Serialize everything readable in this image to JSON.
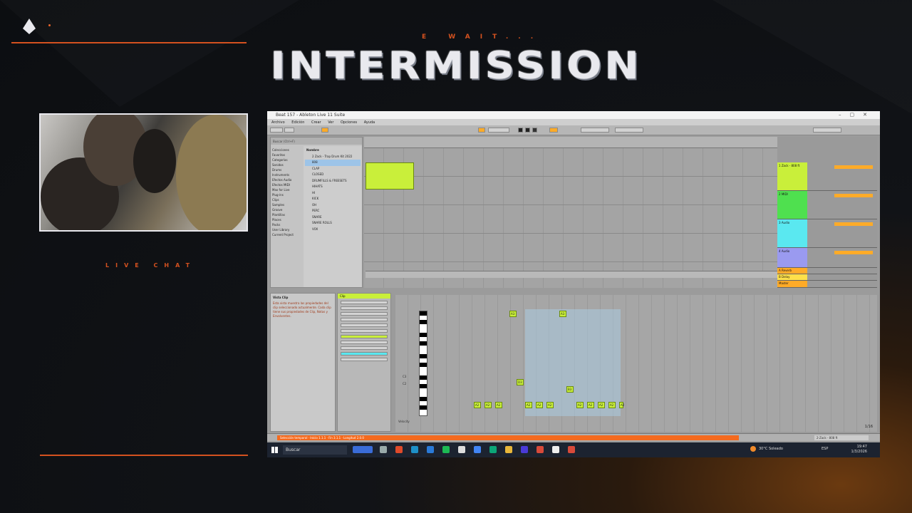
{
  "overlay": {
    "wait_text": "E WAIT...",
    "title": "INTERMISSION",
    "live_chat_label": "LIVE CHAT"
  },
  "colors": {
    "accent": "#d4511f",
    "clip_green": "#c9ef3a",
    "ableton_orange": "#ffab28"
  },
  "ableton": {
    "window_title": "Beat 157 - Ableton Live 11 Suite",
    "menu": [
      "Archivo",
      "Edición",
      "Crear",
      "Ver",
      "Opciones",
      "Ayuda"
    ],
    "browser": {
      "search_placeholder": "Buscar (Ctrl+F)",
      "categories": [
        "Colecciones",
        "Favoritos",
        "Categorías",
        "Sonidos",
        "Drums",
        "Instruments",
        "Efectos Audio",
        "Efectos MIDI",
        "Max for Live",
        "Plug-ins",
        "Clips",
        "Samples",
        "Groove",
        "Plantillas",
        "Places",
        "Packs",
        "User Library",
        "Current Project"
      ],
      "header": "Nombre",
      "items": [
        "2 Zack - Trap Drum Kit 2022",
        "808",
        "CLAP",
        "CLOSED",
        "DRUMFILLS & FREESETS",
        "HIHATS",
        "HI",
        "KICK",
        "OH",
        "PERC",
        "SNARE",
        "SNARE ROLLS",
        "VOX"
      ]
    },
    "tracks": [
      {
        "name": "1 Zack - 808 ft",
        "color": "#c9ef3a"
      },
      {
        "name": "2 MIDI",
        "color": "#4fe04f"
      },
      {
        "name": "3 Audio",
        "color": "#5ae8f0"
      },
      {
        "name": "4 Audio",
        "color": "#9a9af0"
      },
      {
        "name": "A Reverb",
        "color": "#ffab28"
      },
      {
        "name": "B Delay",
        "color": "#ffe04a"
      },
      {
        "name": "Master",
        "color": "#ffab28"
      }
    ],
    "detail_title": "Vista Clip",
    "detail_text": "Esta vista muestra las propiedades del clip seleccionado actualmente. Cada clip tiene sus propiedades de Clip, Notas y Envolventes.",
    "clip_header": "Clip",
    "piano_labels": [
      "C3",
      "C2"
    ],
    "notes": [
      "A3",
      "A3",
      "D3",
      "B3",
      "A2",
      "A2",
      "A2",
      "A2",
      "A2",
      "A2",
      "A2",
      "A2",
      "A2",
      "A2",
      "A2"
    ],
    "page_indicator": "1/16",
    "velocity_label": "Velocity",
    "status_text": "Selección temporal · Inicio 1.1.1 · Fin 3.1.1 · Longitud 2.0.0",
    "master_label": "2-Zack - 808 ft",
    "taskbar": {
      "search_placeholder": "Buscar",
      "weather": "30°C Soleado",
      "lang": "ESP",
      "time": "19:47",
      "date": "1/3/2026"
    }
  }
}
